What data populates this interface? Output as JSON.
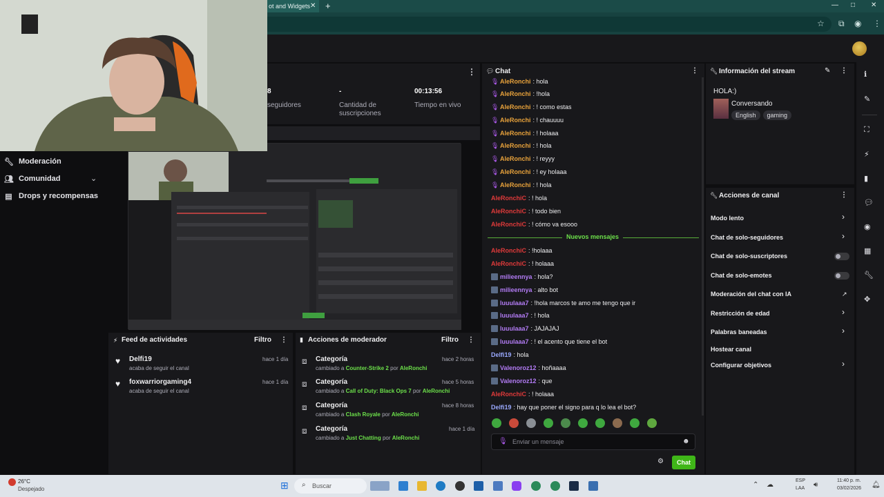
{
  "browser": {
    "tab_title": "ot and Widgets",
    "tab_close": "✕",
    "new_tab": "+",
    "min": "—",
    "max": "□",
    "close": "✕"
  },
  "sidebar": {
    "items": [
      {
        "label": "Moderación",
        "icon": "wrench-icon"
      },
      {
        "label": "Comunidad",
        "icon": "people-icon"
      },
      {
        "label": "Drops y recompensas",
        "icon": "gift-icon"
      }
    ]
  },
  "stats": {
    "followers_value": "8",
    "followers_label": "seguidores",
    "subs_value": "-",
    "subs_label_1": "Cantidad de",
    "subs_label_2": "suscripciones",
    "live_value": "00:13:56",
    "live_label": "Tiempo en vivo"
  },
  "feed": {
    "title": "Feed de actividades",
    "filter": "Filtro",
    "items": [
      {
        "name": "Delfi19",
        "desc": "acaba de seguir el canal",
        "time": "hace 1 día"
      },
      {
        "name": "foxwarriorgaming4",
        "desc": "acaba de seguir el canal",
        "time": "hace 1 día"
      }
    ]
  },
  "mod_actions": {
    "title": "Acciones de moderador",
    "filter": "Filtro",
    "items": [
      {
        "title": "Categoría",
        "prefix": "cambiado a",
        "target": "Counter-Strike 2",
        "by": "por",
        "user": "AleRonchi",
        "time": "hace 2 horas"
      },
      {
        "title": "Categoría",
        "prefix": "cambiado a",
        "target": "Call of Duty: Black Ops 7",
        "by": "por",
        "user": "AleRonchi",
        "time": "hace 5 horas"
      },
      {
        "title": "Categoría",
        "prefix": "cambiado a",
        "target": "Clash Royale",
        "by": "por",
        "user": "AleRonchi",
        "time": "hace 8 horas"
      },
      {
        "title": "Categoría",
        "prefix": "cambiado a",
        "target": "Just Chatting",
        "by": "por",
        "user": "AleRonchi",
        "time": "hace 1 día"
      }
    ]
  },
  "chat": {
    "title": "Chat",
    "new_messages": "Nuevos mensajes",
    "input_placeholder": "Enviar un mensaje",
    "send_label": "Chat",
    "messages": [
      {
        "user": "AleRonchi",
        "text": ": hola",
        "color": "orange",
        "badge": "mic"
      },
      {
        "user": "AleRonchi",
        "text": ": !hola",
        "color": "orange",
        "badge": "mic"
      },
      {
        "user": "AleRonchi",
        "text": ": ! como estas",
        "color": "orange",
        "badge": "mic"
      },
      {
        "user": "AleRonchi",
        "text": ": ! chauuuu",
        "color": "orange",
        "badge": "mic"
      },
      {
        "user": "AleRonchi",
        "text": ": ! holaaa",
        "color": "orange",
        "badge": "mic"
      },
      {
        "user": "AleRonchi",
        "text": ": ! hola",
        "color": "orange",
        "badge": "mic"
      },
      {
        "user": "AleRonchi",
        "text": ": ! reyyy",
        "color": "orange",
        "badge": "mic"
      },
      {
        "user": "AleRonchi",
        "text": ": ! ey holaaa",
        "color": "orange",
        "badge": "mic"
      },
      {
        "user": "AleRonchi",
        "text": ": ! hola",
        "color": "orange",
        "badge": "mic"
      },
      {
        "user": "AleRonchiC",
        "text": ": ! hola",
        "color": "red",
        "badge": ""
      },
      {
        "user": "AleRonchiC",
        "text": ": ! todo bien",
        "color": "red",
        "badge": ""
      },
      {
        "user": "AleRonchiC",
        "text": ": ! cómo va esooo",
        "color": "red",
        "badge": ""
      },
      {
        "user": "AleRonchiC",
        "text": ": !holaaa",
        "color": "red",
        "badge": ""
      },
      {
        "user": "AleRonchiC",
        "text": ": ! holaaa",
        "color": "red",
        "badge": ""
      },
      {
        "user": "milieennya",
        "text": ": hola?",
        "color": "purple",
        "badge": "sq"
      },
      {
        "user": "milieennya",
        "text": ": alto bot",
        "color": "purple",
        "badge": "sq"
      },
      {
        "user": "luuulaaa7",
        "text": ": !hola marcos te amo me tengo que ir",
        "color": "purple",
        "badge": "sq"
      },
      {
        "user": "luuulaaa7",
        "text": ": ! hola",
        "color": "purple",
        "badge": "sq"
      },
      {
        "user": "luuulaaa7",
        "text": ": JAJAJAJ",
        "color": "purple",
        "badge": "sq"
      },
      {
        "user": "luuulaaa7",
        "text": ": ! el acento que tiene el bot",
        "color": "purple",
        "badge": "sq"
      },
      {
        "user": "Delfi19",
        "text": ": hola",
        "color": "blue",
        "badge": ""
      },
      {
        "user": "Valenoroz12",
        "text": ": hoñaaaa",
        "color": "purple",
        "badge": "sq"
      },
      {
        "user": "Valenoroz12",
        "text": ": que",
        "color": "purple",
        "badge": "sq"
      },
      {
        "user": "AleRonchiC",
        "text": ": ! holaaa",
        "color": "red",
        "badge": ""
      },
      {
        "user": "Delfi19",
        "text": ": hay que poner el signo para q lo lea el bot?",
        "color": "blue",
        "badge": ""
      }
    ]
  },
  "stream_info": {
    "title": "Información del stream",
    "stream_title": "HOLA:)",
    "category": "Conversando",
    "tags": [
      "English",
      "gaming"
    ]
  },
  "channel_actions": {
    "title": "Acciones de canal",
    "items": [
      {
        "label": "Modo lento",
        "control": "chevron"
      },
      {
        "label": "Chat de solo-seguidores",
        "control": "chevron"
      },
      {
        "label": "Chat de solo-suscriptores",
        "control": "toggle"
      },
      {
        "label": "Chat de solo-emotes",
        "control": "toggle"
      },
      {
        "label": "Moderación del chat con IA",
        "control": "chart"
      },
      {
        "label": "Restricción de edad",
        "control": "chevron"
      },
      {
        "label": "Palabras baneadas",
        "control": "chevron"
      },
      {
        "label": "Hostear canal",
        "control": "none"
      },
      {
        "label": "Configurar objetivos",
        "control": "chevron"
      }
    ]
  },
  "taskbar": {
    "weather_temp": "26°C",
    "weather_desc": "Despejado",
    "search_label": "Buscar",
    "lang_1": "ESP",
    "lang_2": "LAA",
    "time": "11:40 p. m.",
    "date": "03/02/2026"
  },
  "colors": {
    "accent_green": "#3fb618",
    "twitch_bg": "#18181b",
    "browser_teal": "#1b4b48"
  }
}
